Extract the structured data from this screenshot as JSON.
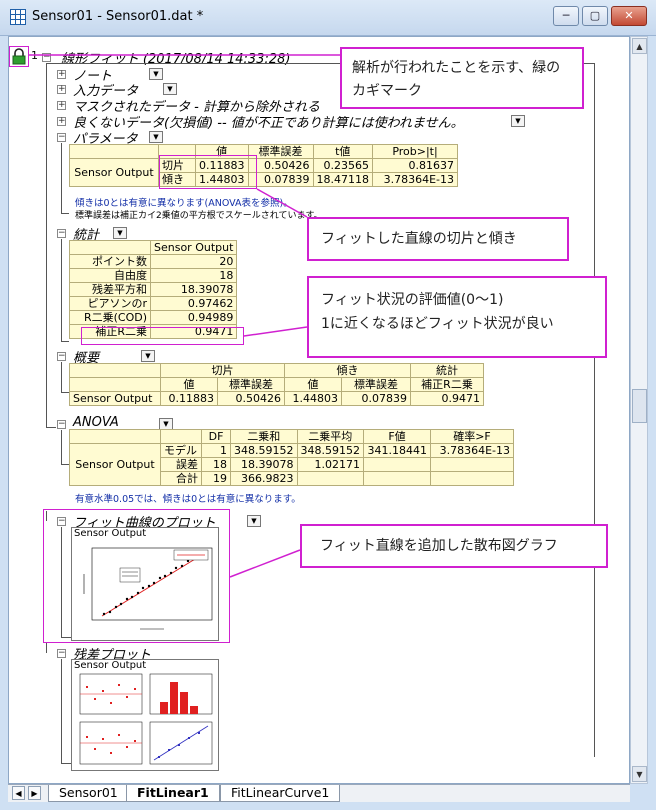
{
  "window": {
    "title": "Sensor01 - Sensor01.dat *",
    "btn_min": "─",
    "btn_max": "▢",
    "btn_close": "✕"
  },
  "tree": {
    "node_no": "1"
  },
  "headings": {
    "main": "線形フィット (2017/08/14 14:33:28)",
    "notes": "ノート",
    "input": "入力データ",
    "masked": "マスクされたデータ - 計算から除外される",
    "bad": "良くないデータ(欠損値) -- 値が不正であり計算には使われません。",
    "params": "パラメータ",
    "stats": "統計",
    "summary": "概要",
    "anova": "ANOVA",
    "fitplot": "フィット曲線のプロット",
    "resid": "残差プロット"
  },
  "params": {
    "header": [
      "値",
      "標準誤差",
      "t値",
      "Prob>|t|"
    ],
    "group": "Sensor Output",
    "rows": [
      {
        "name": "切片",
        "vals": [
          "0.11883",
          "0.50426",
          "0.23565",
          "0.81637"
        ]
      },
      {
        "name": "傾き",
        "vals": [
          "1.44803",
          "0.07839",
          "18.47118",
          "3.78364E-13"
        ]
      }
    ],
    "note1": "傾きは0とは有意に異なります(ANOVA表を参照)。",
    "note2": "標準誤差は補正カイ2乗値の平方根でスケールされています。"
  },
  "stats": {
    "header": "Sensor Output",
    "rows": [
      {
        "name": "ポイント数",
        "val": "20"
      },
      {
        "name": "自由度",
        "val": "18"
      },
      {
        "name": "残差平方和",
        "val": "18.39078"
      },
      {
        "name": "ピアソンのr",
        "val": "0.97462"
      },
      {
        "name": "R二乗(COD)",
        "val": "0.94989"
      },
      {
        "name": "補正R二乗",
        "val": "0.9471"
      }
    ]
  },
  "summary": {
    "groups": [
      "切片",
      "傾き",
      "統計"
    ],
    "sub": [
      "値",
      "標準誤差",
      "値",
      "標準誤差",
      "補正R二乗"
    ],
    "row_name": "Sensor Output",
    "vals": [
      "0.11883",
      "0.50426",
      "1.44803",
      "0.07839",
      "0.9471"
    ]
  },
  "anova": {
    "header": [
      "DF",
      "二乗和",
      "二乗平均",
      "F値",
      "確率>F"
    ],
    "group": "Sensor Output",
    "rows": [
      {
        "name": "モデル",
        "vals": [
          "1",
          "348.59152",
          "348.59152",
          "341.18441",
          "3.78364E-13"
        ]
      },
      {
        "name": "誤差",
        "vals": [
          "18",
          "18.39078",
          "1.02171",
          "",
          ""
        ]
      },
      {
        "name": "合計",
        "vals": [
          "19",
          "366.9823",
          "",
          "",
          ""
        ]
      }
    ],
    "note": "有意水準0.05では、傾きは0とは有意に異なります。"
  },
  "graphs": {
    "fit_title": "Sensor Output",
    "resid_title": "Sensor Output"
  },
  "callouts": {
    "lock": "解析が行われたことを示す、緑のカギマーク",
    "params": "フィットした直線の切片と傾き",
    "stats_l1": "フィット状況の評価値(0〜1)",
    "stats_l2": "1に近くなるほどフィット状況が良い",
    "graph": "フィット直線を追加した散布図グラフ"
  },
  "tabs": [
    "Sensor01",
    "FitLinear1",
    "FitLinearCurve1"
  ],
  "colors": {
    "accent": "#d020d0",
    "table_bg": "#fffbd2",
    "note_blue": "#1430a8",
    "lock": "#2e9e2e"
  }
}
